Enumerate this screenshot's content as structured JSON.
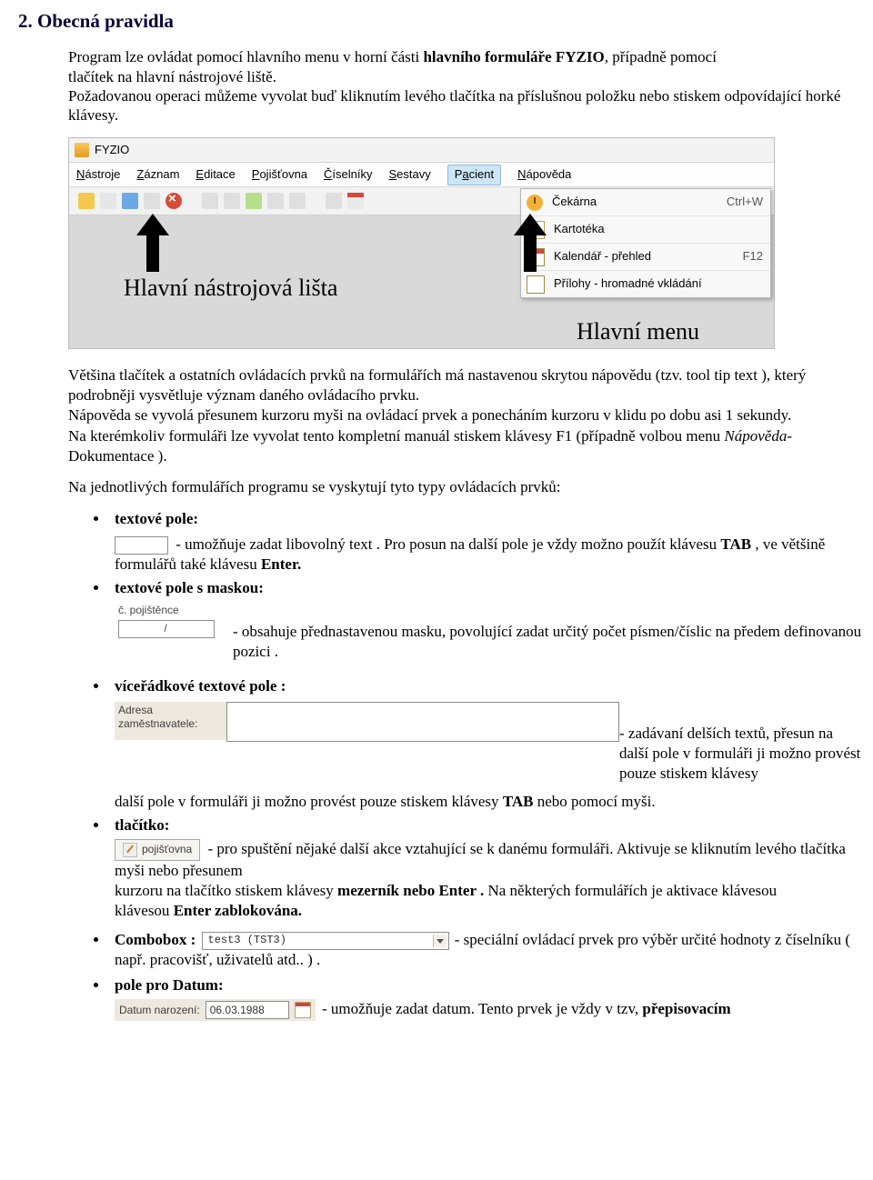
{
  "heading": "2.  Obecná pravidla",
  "para1": {
    "t1": "Program lze ovládat pomocí hlavního menu  v horní části ",
    "b1": "hlavního formuláře FYZIO",
    "t2": ", případně pomocí ",
    "t3": "tlačítek na hlavní nástrojové liště.",
    "t4": "Požadovanou operaci můžeme vyvolat buď kliknutím levého tlačítka na příslušnou položku nebo stiskem odpovídající horké klávesy."
  },
  "app": {
    "title": "FYZIO",
    "menu": [
      "Nástroje",
      "Záznam",
      "Editace",
      "Pojišťovna",
      "Číselníky",
      "Sestavy",
      "Pacient",
      "Nápověda"
    ],
    "dropdown": [
      {
        "label": "Čekárna",
        "shortcut": "Ctrl+W"
      },
      {
        "label": "Kartotéka",
        "shortcut": ""
      },
      {
        "label": "Kalendář - přehled",
        "shortcut": "F12"
      },
      {
        "label": "Přílohy - hromadné vkládání",
        "shortcut": ""
      }
    ]
  },
  "ann": {
    "toolbar": "Hlavní nástrojová lišta",
    "menu": "Hlavní menu"
  },
  "para2a": "Většina tlačítek a ostatních ovládacích prvků na formulářích má nastavenou skrytou nápovědu (tzv. tool tip text ), který podrobněji vysvětluje význam daného ovládacího prvku.",
  "para2b": "Nápověda se vyvolá přesunem kurzoru myši na ovládací prvek a ponecháním kurzoru v klidu po dobu asi 1 sekundy.",
  "para2c_1": "Na kterémkoliv formuláři lze vyvolat tento kompletní manuál stiskem klávesy F1 (případně volbou menu ",
  "para2c_i": "Nápověda-",
  "para2c_2": "Dokumentace ).",
  "para3": "Na jednotlivých formulářích programu se vyskytují tyto typy ovládacích prvků:",
  "items": {
    "textfield": {
      "title": "textové pole:",
      "t1": "- umožňuje zadat libovolný text . Pro posun na další pole je vždy možno použít klávesu ",
      "b1": "TAB",
      "t2": " , ve většině formulářů také klávesu ",
      "b2": "Enter."
    },
    "mask": {
      "title": "textové pole s maskou:",
      "label": "č. pojištěnce",
      "value": "/",
      "desc": "- obsahuje přednastavenou masku, povolující zadat určitý počet písmen/číslic na předem definovanou pozici ."
    },
    "multi": {
      "title": "víceřádkové textové pole :",
      "label": "Adresa zaměstnavatele:",
      "t1": "- zadávaní delších textů, přesun na další pole v formuláři ji možno provést pouze stiskem klávesy ",
      "b1": "TAB",
      "t2": " nebo pomocí myši."
    },
    "btn": {
      "title": "tlačítko:",
      "label": "pojišťovna",
      "t1": "- pro spuštění nějaké další akce vztahující se k danému formuláři. Aktivuje se kliknutím levého tlačítka myši nebo přesunem",
      "t2": "kurzoru na tlačítko stiskem klávesy ",
      "b1": "mezerník nebo Enter .",
      "t3": " Na některých formulářích je aktivace klávesou ",
      "b2": "Enter zablokována."
    },
    "combo": {
      "title": "Combobox :",
      "value": "test3          (TST3)",
      "desc": "- speciální ovládací prvek pro výběr určité hodnoty z číselníku ( např. pracovišť, uživatelů atd.. ) ."
    },
    "date": {
      "title": "pole pro Datum:",
      "label": "Datum narození:",
      "value": "06.03.1988",
      "t1": "- umožňuje zadat datum. Tento prvek je vždy v tzv, ",
      "b1": "přepisovacím"
    }
  }
}
